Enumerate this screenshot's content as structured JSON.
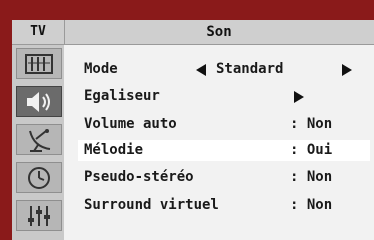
{
  "header": {
    "tv_label": "TV",
    "title": "Son"
  },
  "sidebar": {
    "icons": [
      "picture-icon",
      "sound-icon",
      "antenna-icon",
      "clock-icon",
      "settings-icon"
    ],
    "active": "sound-icon"
  },
  "menu": {
    "items": [
      {
        "label": "Mode",
        "value": "Standard"
      },
      {
        "label": "Egaliseur",
        "value": ""
      },
      {
        "label": "Volume auto",
        "value": ": Non"
      },
      {
        "label": "Mélodie",
        "value": ": Oui"
      },
      {
        "label": "Pseudo-stéréo",
        "value": ": Non"
      },
      {
        "label": "Surround virtuel",
        "value": ": Non"
      }
    ],
    "selected_index": 3
  },
  "colors": {
    "frame": "#8a1a1a",
    "panel": "#f2f2f2",
    "highlight": "#ffffff",
    "header": "#cfcfcf"
  }
}
